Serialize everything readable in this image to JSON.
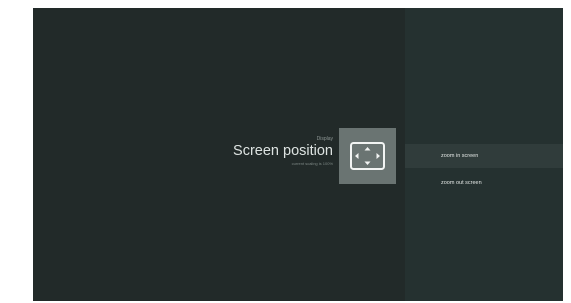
{
  "header": {
    "category": "Display",
    "title": "Screen position",
    "subtitle": "current scaling is 100%"
  },
  "icon": {
    "name": "screen-position-icon"
  },
  "menu": {
    "items": [
      {
        "label": "zoom in screen",
        "selected": true
      },
      {
        "label": "zoom out screen",
        "selected": false
      }
    ]
  },
  "colors": {
    "background": "#222a29",
    "side_panel": "#253130",
    "selected_item": "#303c3b",
    "icon_tile": "#6a7472"
  }
}
